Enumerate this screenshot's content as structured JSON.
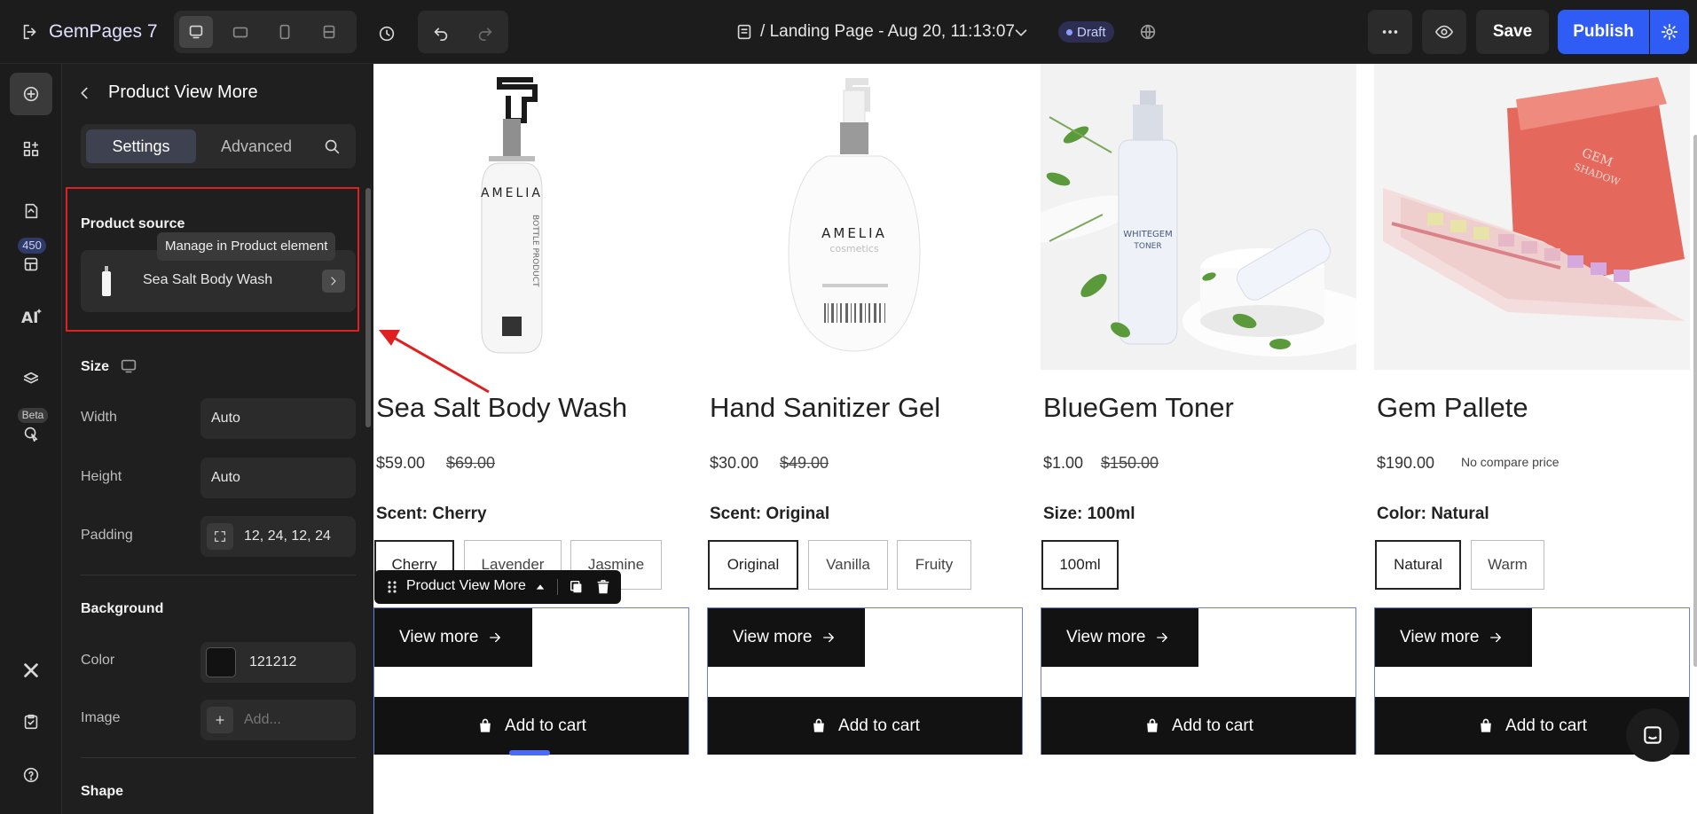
{
  "app": {
    "name": "GemPages 7"
  },
  "topbar": {
    "page_path_prefix": "/",
    "page_title": "Landing Page - Aug 20, 11:13:07",
    "status": "Draft",
    "save_label": "Save",
    "publish_label": "Publish"
  },
  "rail": {
    "badge_count": "450",
    "beta_label": "Beta"
  },
  "panel": {
    "title": "Product View More",
    "tabs": {
      "settings": "Settings",
      "advanced": "Advanced"
    },
    "product_source": {
      "label": "Product source",
      "tooltip": "Manage in Product element",
      "product_name": "Sea Salt Body Wash"
    },
    "size": {
      "label": "Size",
      "width_label": "Width",
      "width_value": "Auto",
      "height_label": "Height",
      "height_value": "Auto",
      "padding_label": "Padding",
      "padding_value": "12, 24, 12, 24"
    },
    "background": {
      "label": "Background",
      "color_label": "Color",
      "color_value": "121212",
      "color_hex": "#121212",
      "image_label": "Image",
      "image_placeholder": "Add..."
    },
    "shape": {
      "label": "Shape"
    }
  },
  "canvas": {
    "selection_label": "Product View More",
    "products": [
      {
        "title": "Sea Salt Body Wash",
        "price": "$59.00",
        "compare_price": "$69.00",
        "option_label": "Scent: Cherry",
        "options": [
          "Cherry",
          "Lavender",
          "Jasmine"
        ],
        "view_more": "View more",
        "add_to_cart": "Add to cart"
      },
      {
        "title": "Hand Sanitizer Gel",
        "price": "$30.00",
        "compare_price": "$49.00",
        "option_label": "Scent: Original",
        "options": [
          "Original",
          "Vanilla",
          "Fruity"
        ],
        "view_more": "View more",
        "add_to_cart": "Add to cart"
      },
      {
        "title": "BlueGem Toner",
        "price": "$1.00",
        "compare_price": "$150.00",
        "option_label": "Size: 100ml",
        "options": [
          "100ml"
        ],
        "view_more": "View more",
        "add_to_cart": "Add to cart"
      },
      {
        "title": "Gem Pallete",
        "price": "$190.00",
        "compare_price": "No compare price",
        "option_label": "Color: Natural",
        "options": [
          "Natural",
          "Warm"
        ],
        "view_more": "View more",
        "add_to_cart": "Add to cart"
      }
    ],
    "image_text": {
      "amelia": "AMELIA",
      "bottle_product": "BOTTLE PRODUCT",
      "cosmetics": "cosmetics",
      "whitegem": "WHITEGEM",
      "toner": "TONER",
      "gem_shadow": "GEM SHADOW"
    }
  },
  "colors": {
    "publish": "#2f5cf5",
    "accent_select": "#6a7ee0",
    "highlight": "#e02020"
  }
}
